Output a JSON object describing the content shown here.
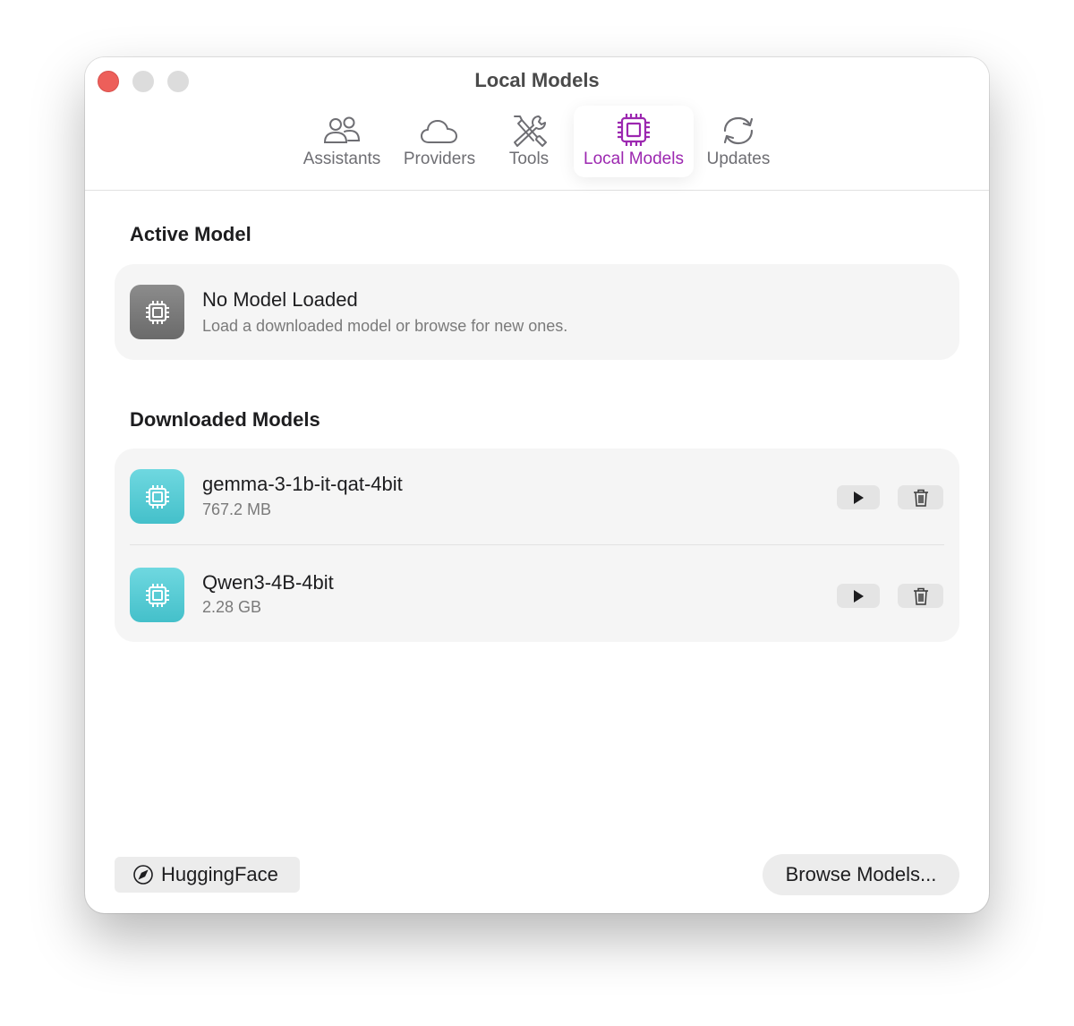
{
  "window": {
    "title": "Local Models"
  },
  "tabs": [
    {
      "label": "Assistants",
      "icon": "people-icon"
    },
    {
      "label": "Providers",
      "icon": "cloud-icon"
    },
    {
      "label": "Tools",
      "icon": "tools-icon"
    },
    {
      "label": "Local Models",
      "icon": "cpu-icon",
      "active": true
    },
    {
      "label": "Updates",
      "icon": "refresh-icon"
    }
  ],
  "active_model": {
    "section_title": "Active Model",
    "title": "No Model Loaded",
    "subtitle": "Load a downloaded model or browse for new ones."
  },
  "downloaded": {
    "section_title": "Downloaded Models",
    "models": [
      {
        "name": "gemma-3-1b-it-qat-4bit",
        "size": "767.2 MB"
      },
      {
        "name": "Qwen3-4B-4bit",
        "size": "2.28 GB"
      }
    ]
  },
  "footer": {
    "huggingface_label": "HuggingFace",
    "browse_label": "Browse Models..."
  },
  "colors": {
    "accent": "#9c27b0",
    "model_icon": "#4fc7d0",
    "close": "#ed5f5a"
  }
}
